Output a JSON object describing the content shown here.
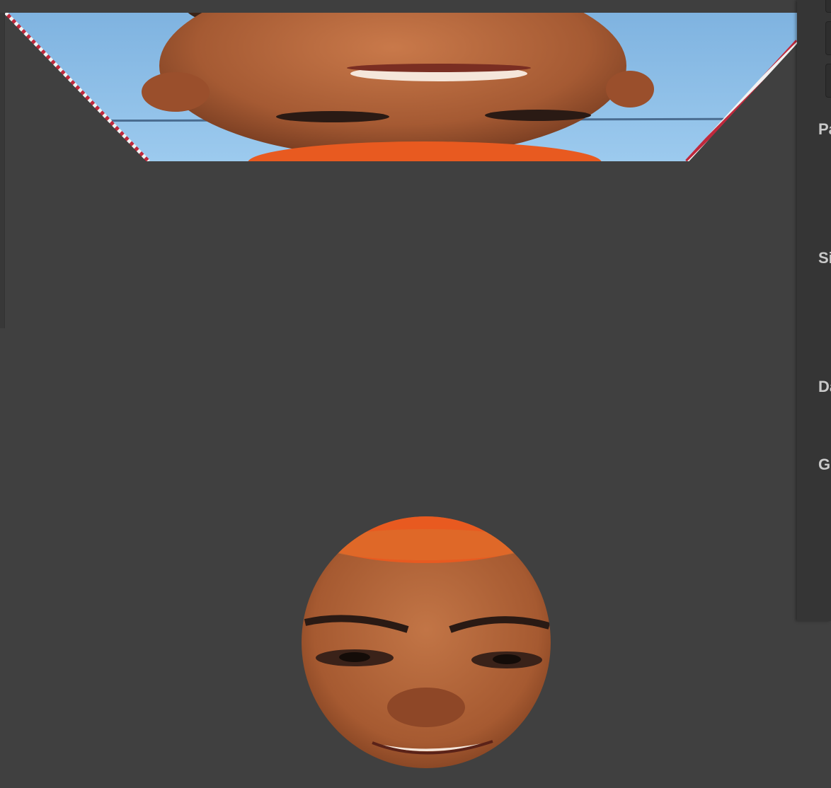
{
  "side_panel": {
    "sections": [
      {
        "label": "Pa"
      },
      {
        "label": "Si"
      },
      {
        "label": "Da"
      },
      {
        "label": "Gl"
      }
    ]
  },
  "colors": {
    "background": "#404040",
    "panel": "#353535",
    "crop_border_red": "#c0283c",
    "crop_border_white": "#f2f2f2",
    "sky": "#8cbde6",
    "skin": "#b8683f",
    "hair": "#e85a20"
  },
  "icons": [
    "crop-handle-icon"
  ]
}
